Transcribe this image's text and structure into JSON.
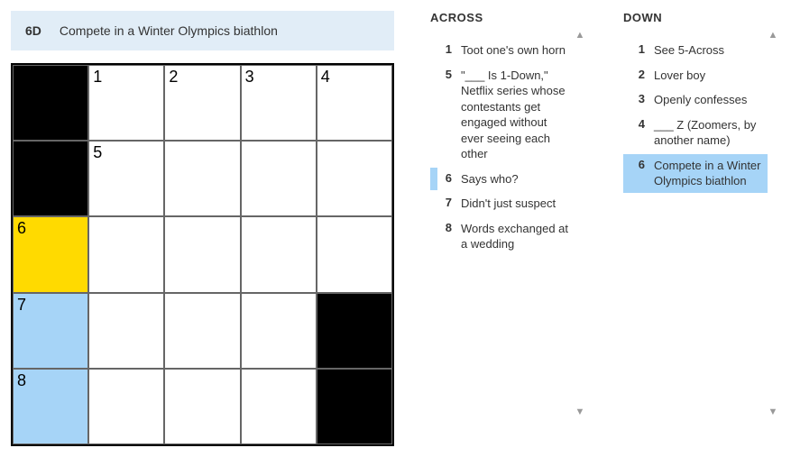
{
  "current_clue": {
    "id": "6D",
    "text": "Compete in a Winter Olympics biathlon"
  },
  "grid": {
    "rows": 5,
    "cols": 5,
    "cells": [
      [
        {
          "black": true
        },
        {
          "num": "1"
        },
        {
          "num": "2"
        },
        {
          "num": "3"
        },
        {
          "num": "4"
        }
      ],
      [
        {
          "black": true
        },
        {
          "num": "5"
        },
        {},
        {},
        {}
      ],
      [
        {
          "num": "6",
          "state": "cursor"
        },
        {},
        {},
        {},
        {}
      ],
      [
        {
          "num": "7",
          "state": "highlight"
        },
        {},
        {},
        {},
        {
          "black": true
        }
      ],
      [
        {
          "num": "8",
          "state": "highlight"
        },
        {},
        {},
        {},
        {
          "black": true
        }
      ]
    ]
  },
  "across": {
    "heading": "ACROSS",
    "clues": [
      {
        "num": "1",
        "text": "Toot one's own horn"
      },
      {
        "num": "5",
        "text": "\"___ Is 1-Down,\" Netflix series whose contestants get engaged without ever seeing each other"
      },
      {
        "num": "6",
        "text": "Says who?",
        "related": true
      },
      {
        "num": "7",
        "text": "Didn't just suspect"
      },
      {
        "num": "8",
        "text": "Words exchanged at a wedding"
      }
    ]
  },
  "down": {
    "heading": "DOWN",
    "clues": [
      {
        "num": "1",
        "text": "See 5-Across"
      },
      {
        "num": "2",
        "text": "Lover boy"
      },
      {
        "num": "3",
        "text": "Openly confesses"
      },
      {
        "num": "4",
        "text": "___ Z (Zoomers, by another name)"
      },
      {
        "num": "6",
        "text": "Compete in a Winter Olympics biathlon",
        "selected": true
      }
    ]
  }
}
